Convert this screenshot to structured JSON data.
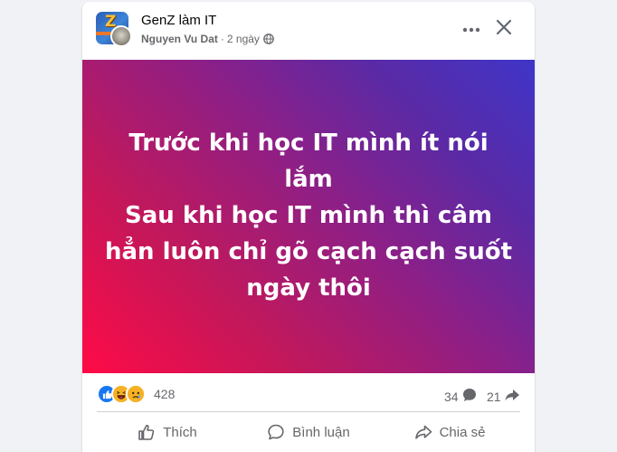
{
  "post": {
    "group_name": "GenZ làm IT",
    "author": "Nguyen Vu Dat",
    "separator": "·",
    "time": "2 ngày",
    "body": "Trước khi học IT mình ít nói lắm\nSau khi học IT mình thì câm hẳn luôn chỉ gõ cạch cạch suốt ngày thôi",
    "banner_colors": [
      "#ff0a46",
      "#8e1f86",
      "#3f35c8"
    ]
  },
  "header": {
    "more_icon": "more-horizontal-icon",
    "close_icon": "close-icon",
    "privacy_icon": "globe-icon"
  },
  "reactions": {
    "types": [
      "like",
      "haha",
      "sad"
    ],
    "count": "428",
    "comments": "34",
    "shares": "21"
  },
  "actions": {
    "like_label": "Thích",
    "comment_label": "Bình luận",
    "share_label": "Chia sẻ"
  },
  "colors": {
    "like_blue": "#1877f2",
    "secondary_text": "#65676b"
  }
}
